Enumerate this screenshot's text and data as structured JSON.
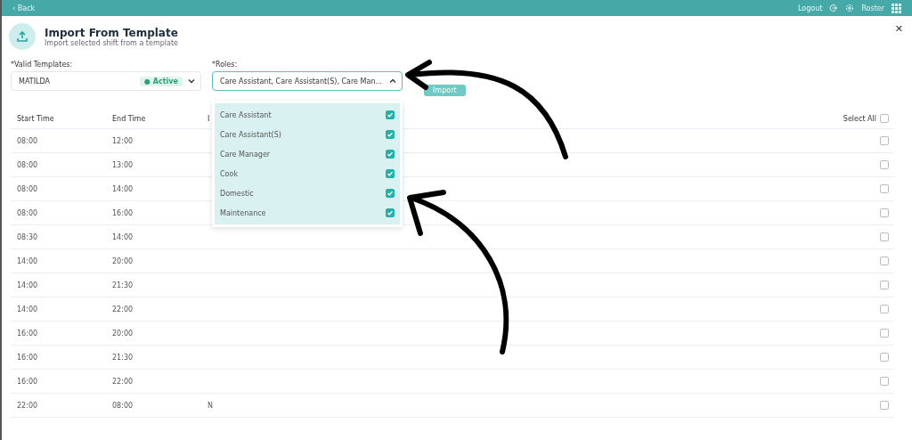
{
  "top_bar": {
    "back_icon": "‹",
    "back": "Back",
    "logout": "Logout",
    "app": "Roster"
  },
  "header": {
    "title": "Import From Template",
    "subtitle": "Import selected shift from a template",
    "close": "✕"
  },
  "templates": {
    "label": "*Valid Templates:",
    "value": "MATILDA",
    "status_dot": "●",
    "status": "Active"
  },
  "roles": {
    "label": "*Roles:",
    "value": "Care Assistant, Care Assistant(S), Care Man...",
    "expanded": true,
    "options": [
      {
        "label": "Care Assistant",
        "checked": true
      },
      {
        "label": "Care Assistant(S)",
        "checked": true
      },
      {
        "label": "Care Manager",
        "checked": true
      },
      {
        "label": "Cook",
        "checked": true
      },
      {
        "label": "Domestic",
        "checked": true
      },
      {
        "label": "Maintenance",
        "checked": true
      }
    ]
  },
  "import_button": "Import",
  "table": {
    "columns": [
      "Start Time",
      "End Time",
      "I"
    ],
    "select_all": {
      "label": "Select All",
      "checked": false
    },
    "rows": [
      {
        "start": "08:00",
        "end": "12:00",
        "checked": false
      },
      {
        "start": "08:00",
        "end": "13:00",
        "checked": false
      },
      {
        "start": "08:00",
        "end": "14:00",
        "checked": false
      },
      {
        "start": "08:00",
        "end": "16:00",
        "checked": false
      },
      {
        "start": "08:30",
        "end": "14:00",
        "checked": false
      },
      {
        "start": "14:00",
        "end": "20:00",
        "checked": false
      },
      {
        "start": "14:00",
        "end": "21:30",
        "checked": false
      },
      {
        "start": "14:00",
        "end": "22:00",
        "checked": false
      },
      {
        "start": "16:00",
        "end": "20:00",
        "checked": false
      },
      {
        "start": "16:00",
        "end": "21:30",
        "checked": false
      },
      {
        "start": "16:00",
        "end": "22:00",
        "checked": false
      },
      {
        "start": "22:00",
        "end": "08:00",
        "column_3": "N",
        "checked": false
      }
    ]
  }
}
